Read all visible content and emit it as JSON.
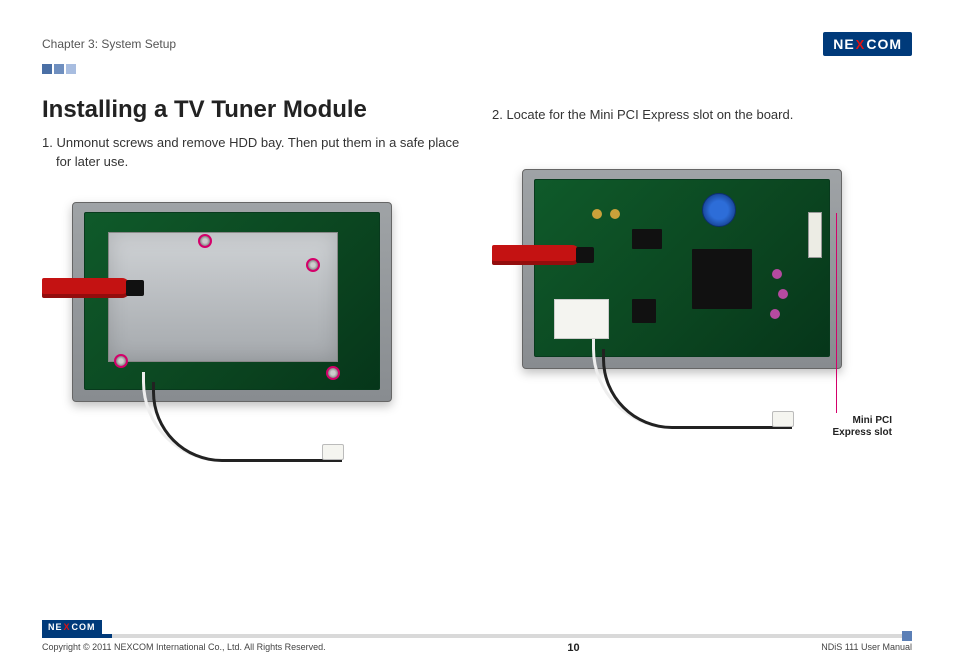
{
  "header": {
    "chapter": "Chapter 3: System Setup",
    "brand_left": "NE",
    "brand_x": "X",
    "brand_right": "COM"
  },
  "section": {
    "title": "Installing a TV Tuner Module",
    "step1": "1. Unmonut screws and remove HDD bay. Then put them in a safe place for later use.",
    "step2": "2. Locate for the Mini PCI Express slot on the board."
  },
  "callouts": {
    "mini_pci_line1": "Mini PCI",
    "mini_pci_line2": "Express slot"
  },
  "footer": {
    "copyright": "Copyright © 2011 NEXCOM International Co., Ltd. All Rights Reserved.",
    "page": "10",
    "doc": "NDiS 111 User Manual",
    "brand_left": "NE",
    "brand_x": "X",
    "brand_right": "COM"
  }
}
